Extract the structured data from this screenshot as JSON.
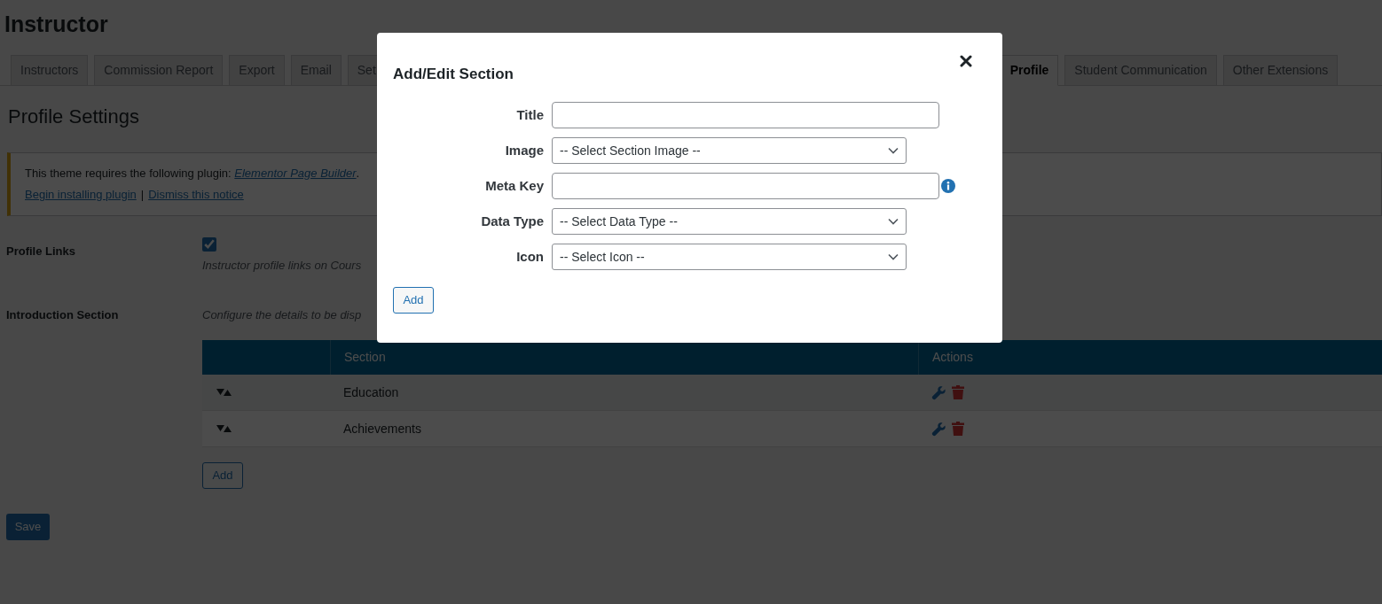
{
  "page_title": "Instructor",
  "tabs": [
    {
      "label": "Instructors",
      "selected": false
    },
    {
      "label": "Commission Report",
      "selected": false
    },
    {
      "label": "Export",
      "selected": false
    },
    {
      "label": "Email",
      "selected": false
    },
    {
      "label": "Set",
      "selected": false
    },
    {
      "label": "Profile",
      "selected": true
    },
    {
      "label": "Student Communication",
      "selected": false
    },
    {
      "label": "Other Extensions",
      "selected": false
    }
  ],
  "heading": "Profile Settings",
  "notice": {
    "text": "This theme requires the following plugin: ",
    "plugin_link": "Elementor Page Builder",
    "text_end": ".",
    "links": [
      "Begin installing plugin",
      "Dismiss this notice"
    ],
    "separator": "|"
  },
  "profile_links": {
    "label": "Profile Links",
    "checked": true,
    "description": "Instructor profile links on Cours"
  },
  "introduction": {
    "label": "Introduction Section",
    "description": "Configure the details to be disp",
    "table": {
      "columns": [
        "",
        "Section",
        "Actions"
      ],
      "rows": [
        {
          "section": "Education"
        },
        {
          "section": "Achievements"
        }
      ]
    },
    "add_button": "Add"
  },
  "save_button": "Save",
  "modal": {
    "title": "Add/Edit Section",
    "fields": [
      {
        "label": "Title",
        "kind": "input",
        "info": false
      },
      {
        "label": "Image",
        "kind": "select",
        "value": "-- Select Section Image --",
        "info": false
      },
      {
        "label": "Meta Key",
        "kind": "input",
        "info": true
      },
      {
        "label": "Data Type",
        "kind": "select",
        "value": "-- Select Data Type --",
        "info": false
      },
      {
        "label": "Icon",
        "kind": "select",
        "value": "-- Select Icon --",
        "info": false
      }
    ],
    "add_button": "Add"
  }
}
